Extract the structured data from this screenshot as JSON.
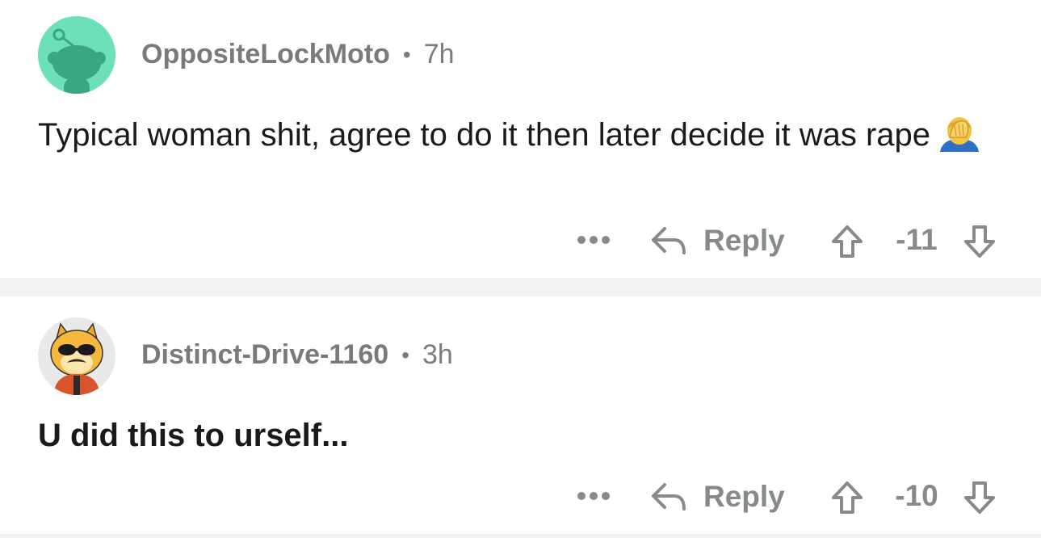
{
  "comments": [
    {
      "username": "OppositeLockMoto",
      "separator": "•",
      "time": "7h",
      "text": "Typical woman shit, agree to do it then later decide it was rape",
      "emoji": "facepalm-emoji",
      "reply_label": "Reply",
      "score": "-11",
      "avatar": "snoo-avatar-mint"
    },
    {
      "username": "Distinct-Drive-1160",
      "separator": "•",
      "time": "3h",
      "text": "U did this to urself...",
      "reply_label": "Reply",
      "score": "-10",
      "avatar": "shiba-avatar-sunglasses"
    }
  ],
  "colors": {
    "meta_text": "#7c7c7c",
    "action_text": "#878a8c",
    "body_text": "#1a1a1b",
    "divider": "#f2f2f2",
    "avatar_mint": "#6ee0b8"
  }
}
